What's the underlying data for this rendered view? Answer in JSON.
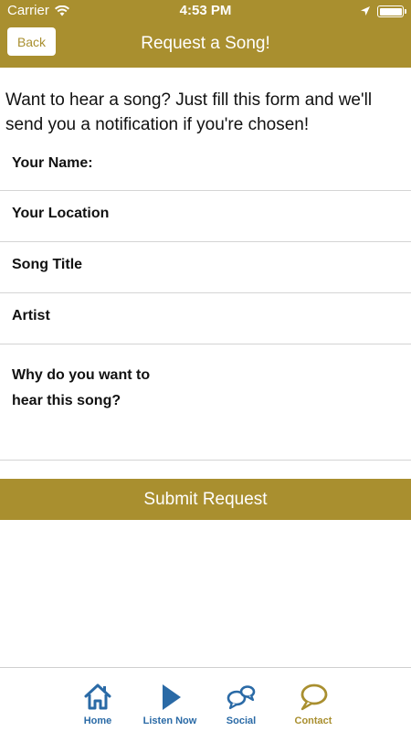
{
  "status_bar": {
    "carrier": "Carrier",
    "time": "4:53 PM"
  },
  "header": {
    "back_label": "Back",
    "title": "Request a Song!"
  },
  "intro": "Want to hear a song? Just fill this form and we'll send you a notification if you're chosen!",
  "form": {
    "name_label": "Your Name:",
    "location_label": "Your Location",
    "song_label": "Song Title",
    "artist_label": "Artist",
    "why_label": "Why do you want to hear this song?"
  },
  "submit_label": "Submit Request",
  "tabs": [
    {
      "label": "Home",
      "icon": "home-icon"
    },
    {
      "label": "Listen Now",
      "icon": "play-icon"
    },
    {
      "label": "Social",
      "icon": "chat-bubbles-icon"
    },
    {
      "label": "Contact",
      "icon": "speech-bubble-icon"
    }
  ],
  "colors": {
    "brand": "#a98f2f",
    "tab_blue": "#2a6aa6",
    "divider": "#d4d4d4"
  }
}
